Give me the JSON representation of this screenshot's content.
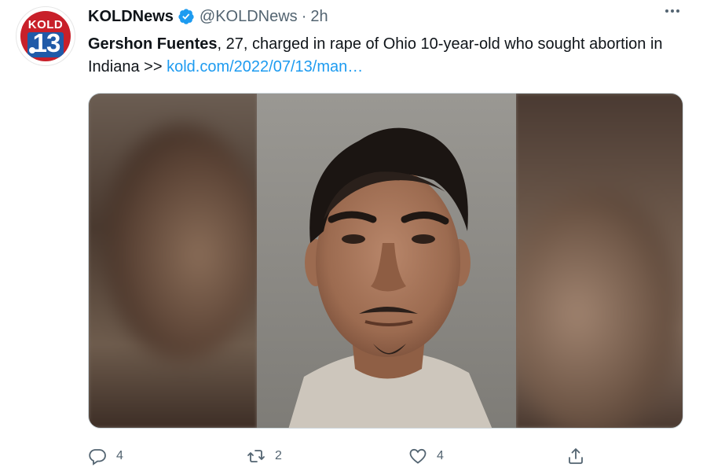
{
  "account": {
    "avatar_text_top": "KOLD",
    "avatar_text_number": "13",
    "display_name": "KOLDNews",
    "handle": "@KOLDNews",
    "separator": "·",
    "time": "2h"
  },
  "tweet": {
    "name_bold": "Gershon Fuentes",
    "text_after_name": ", 27, charged in rape of Ohio 10-year-old who sought abortion in Indiana >> ",
    "link_text": "kold.com/2022/07/13/man…"
  },
  "actions": {
    "reply_count": "4",
    "retweet_count": "2",
    "like_count": "4"
  },
  "colors": {
    "link": "#1d9bf0",
    "secondary_text": "#536471",
    "verified": "#1d9bf0",
    "avatar_red": "#c8202a",
    "avatar_blue": "#1f5aa8"
  },
  "icons": {
    "verified": "verified-badge-icon",
    "more": "more-dots-icon",
    "reply": "reply-icon",
    "retweet": "retweet-icon",
    "like": "heart-icon",
    "share": "share-icon"
  }
}
